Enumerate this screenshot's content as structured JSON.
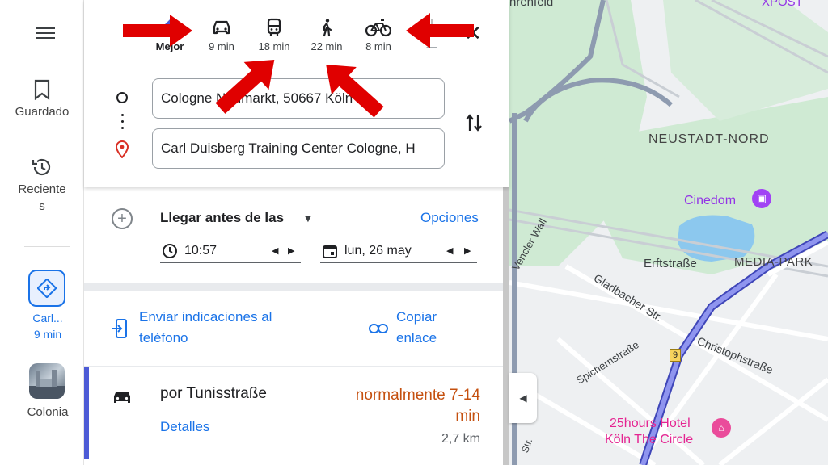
{
  "rail": {
    "menu_icon": "hamburger-menu-icon",
    "saved_label": "Guardado",
    "recents_label_1": "Reciente",
    "recents_label_2": "s",
    "recent_trip_label": "Carl...",
    "recent_trip_time": "9 min",
    "city_label": "Colonia"
  },
  "modes": [
    {
      "label": "Mejor",
      "icon": "diamond-route-icon"
    },
    {
      "label": "9 min",
      "icon": "car-icon"
    },
    {
      "label": "18 min",
      "icon": "bus-icon"
    },
    {
      "label": "22 min",
      "icon": "walk-icon"
    },
    {
      "label": "8 min",
      "icon": "bicycle-icon"
    },
    {
      "label": "—",
      "icon": "flight-icon"
    }
  ],
  "origin": {
    "value": "Cologne Neumarkt, 50667 Köln"
  },
  "destination": {
    "value": "Carl Duisberg Training Center Cologne, H"
  },
  "options": {
    "arrive_label": "Llegar antes de las",
    "options_link": "Opciones",
    "time_value": "10:57",
    "date_value": "lun, 26 may"
  },
  "send": {
    "send_line1": "Enviar indicaciones al",
    "send_line2": "teléfono",
    "copy_line1": "Copiar",
    "copy_line2": "enlace"
  },
  "route": {
    "via": "por Tunisstraße",
    "duration_line1": "normalmente 7-14",
    "duration_line2": "min",
    "details": "Detalles",
    "distance": "2,7 km"
  },
  "map": {
    "labels": {
      "ehrenfeld": "hrenfeld",
      "xpost": "XPOST",
      "neustadt": "NEUSTADT-NORD",
      "cinedom": "Cinedom",
      "erftstrasse": "Erftstraße",
      "mediapark": "MEDIA-PARK",
      "vencler": "Vencler Wall",
      "gladbacher": "Gladbacher Str.",
      "spichern": "Spichernstraße",
      "christoph": "Christophstraße",
      "route9": "9",
      "hotel1": "25hours Hotel",
      "hotel2": "Köln The Circle",
      "stra": "Str."
    }
  },
  "colors": {
    "accent": "#1a73e8",
    "route": "#6b6fe0",
    "duration": "#c5500f",
    "annotation": "#e00000",
    "park": "#cfead3"
  }
}
